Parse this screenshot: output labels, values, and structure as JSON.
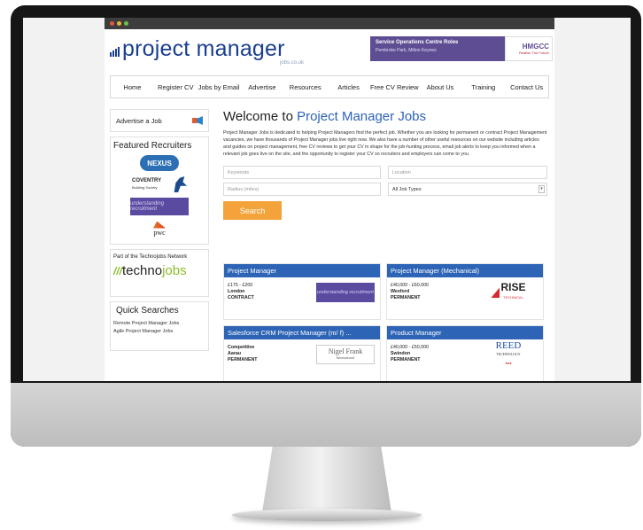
{
  "site": {
    "logo_text": "project manager",
    "logo_sub": "jobs.co.uk"
  },
  "banner": {
    "title": "Service Operations Centre Roles",
    "subtitle": "Pembroke Park, Milton Keynes",
    "brand": "HMGCC",
    "tagline": "Realise The Future"
  },
  "nav": {
    "items": [
      "Home",
      "Register CV",
      "Jobs by Email",
      "Advertise",
      "Resources",
      "Articles",
      "Free CV Review",
      "About Us",
      "Training",
      "Contact Us"
    ]
  },
  "sidebar": {
    "advertise_label": "Advertise a Job",
    "featured_heading": "Featured Recruiters",
    "recruiters": {
      "nexus": "NEXUS",
      "coventry": "COVENTRY",
      "coventry_sub": "Building Society",
      "gadd": "understanding recruitment",
      "pwc": "pwc"
    },
    "network_text": "Part of the Technojobs Network",
    "network_logo_slashes": "///",
    "network_logo_a": "techno",
    "network_logo_b": "jobs",
    "quick_heading": "Quick Searches",
    "quick_links": [
      "Remote Project Manager Jobs",
      "Agile Project Manager Jobs"
    ]
  },
  "main": {
    "welcome_prefix": "Welcome to ",
    "welcome_accent": "Project Manager Jobs",
    "intro": "Project Manager Jobs is dedicated to helping Project Managers find the perfect job. Whether you are looking for permanent or contract Project Management vacancies, we have thousands of Project Manager jobs live right now. We also have a number of other useful resources on our website including articles and guides on project management, free CV reviews to get your CV in shape for the job-hunting process, email job alerts to keep you informed when a relevant job goes live on the site, and the opportunity to register your CV so recruiters and employers can come to you."
  },
  "search": {
    "keywords_placeholder": "Keywords",
    "location_placeholder": "Location",
    "radius_placeholder": "Radius (miles)",
    "job_type_selected": "All Job Types",
    "button_label": "Search"
  },
  "jobs": [
    {
      "title": "Project Manager",
      "salary": "£175 - £200",
      "location": "London",
      "type": "CONTRACT",
      "logo": "understanding recruitment"
    },
    {
      "title": "Project Manager (Mechanical)",
      "salary": "£40,000 - £60,000",
      "location": "Wexford",
      "type": "PERMANENT",
      "logo": "RISE",
      "logo_sub": "TECHNICAL"
    },
    {
      "title": "Salesforce CRM Project Manager (m/ f) ...",
      "salary": "Competitive",
      "location": "Aarau",
      "type": "PERMANENT",
      "logo": "Nigel Frank",
      "logo_sub": "International"
    },
    {
      "title": "Product Manager",
      "salary": "£40,000 - £50,000",
      "location": "Swindon",
      "type": "PERMANENT",
      "logo": "REED",
      "logo_sub": "TECHNOLOGY"
    }
  ],
  "colors": {
    "brand_blue": "#1a3f8f",
    "job_header_blue": "#2d64b5",
    "search_orange": "#f3a33a",
    "technojobs_green": "#8bbc2c"
  }
}
